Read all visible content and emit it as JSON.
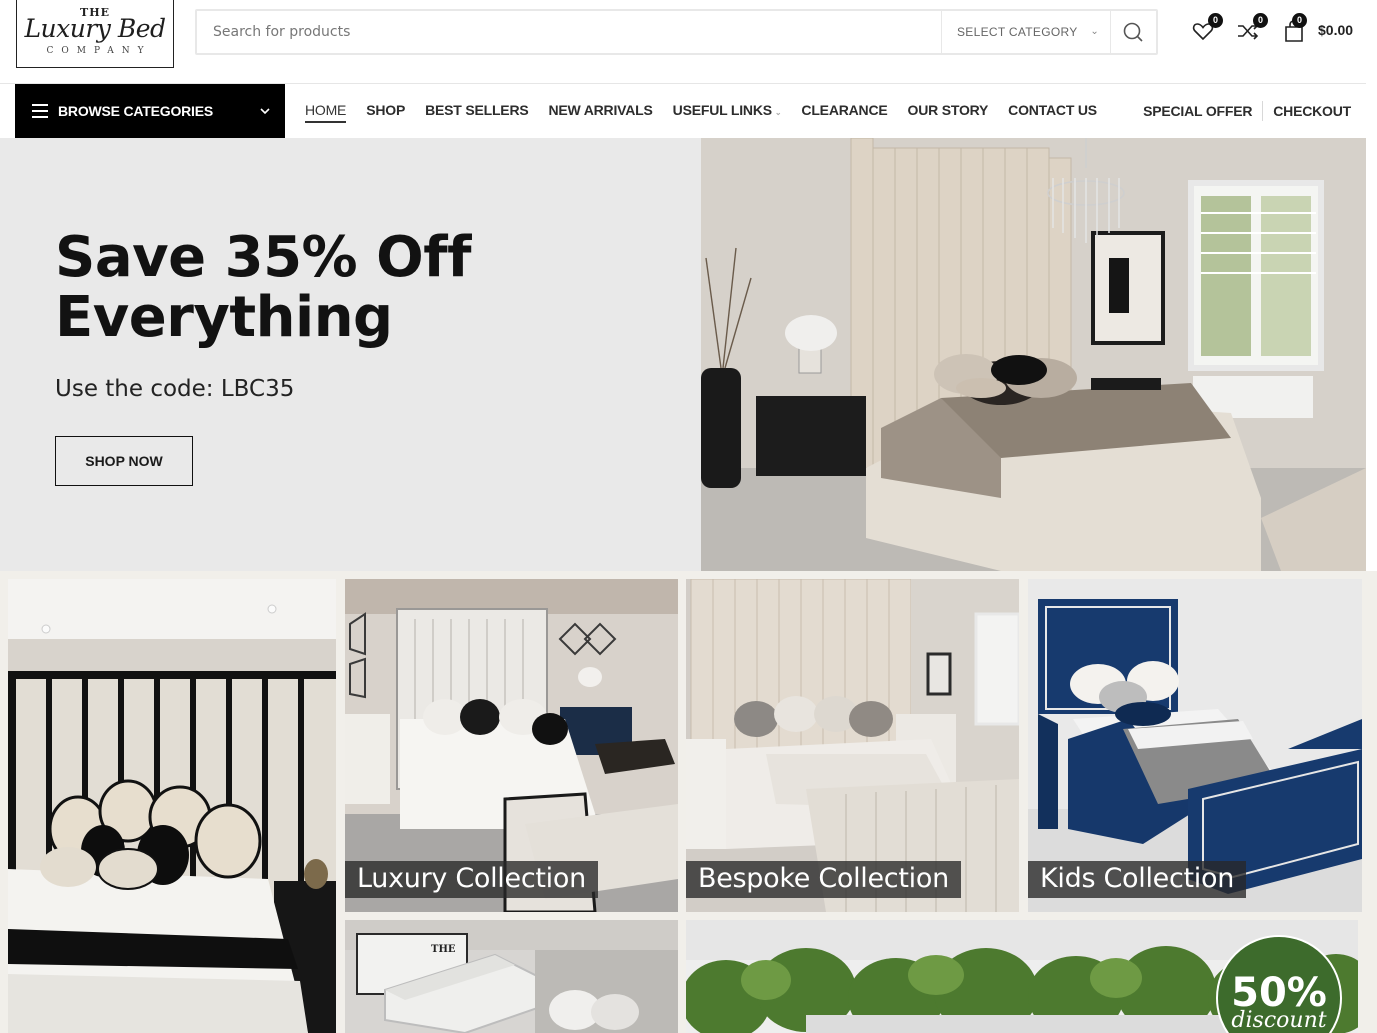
{
  "logo": {
    "line1": "THE",
    "line2": "Luxury Bed",
    "line3": "COMPANY"
  },
  "search": {
    "placeholder": "Search for products",
    "category": "SELECT CATEGORY"
  },
  "header": {
    "wishlist_count": "0",
    "compare_count": "0",
    "cart_count": "0",
    "cart_total": "$0.00"
  },
  "nav": {
    "browse_label": "BROWSE CATEGORIES",
    "items": [
      {
        "label": "HOME"
      },
      {
        "label": "SHOP"
      },
      {
        "label": "BEST SELLERS"
      },
      {
        "label": "NEW ARRIVALS"
      },
      {
        "label": "USEFUL LINKS"
      },
      {
        "label": "CLEARANCE"
      },
      {
        "label": "OUR STORY"
      },
      {
        "label": "CONTACT US"
      }
    ],
    "right": [
      {
        "label": "SPECIAL OFFER"
      },
      {
        "label": "CHECKOUT"
      }
    ]
  },
  "hero": {
    "title": "Save 35% Off Everything",
    "subtitle": "Use the code: LBC35",
    "button": "SHOP NOW"
  },
  "tiles": [
    {
      "label": "Luxury Collection"
    },
    {
      "label": "Bespoke Collection"
    },
    {
      "label": "Kids Collection"
    }
  ],
  "promo": {
    "percent": "50%",
    "word": "discount",
    "mattress_brand": "THE"
  },
  "colors": {
    "accent": "#000000",
    "hero_bg": "#e9e9e9",
    "kids_bed": "#173a6e",
    "promo_badge": "#3d6b2c"
  }
}
